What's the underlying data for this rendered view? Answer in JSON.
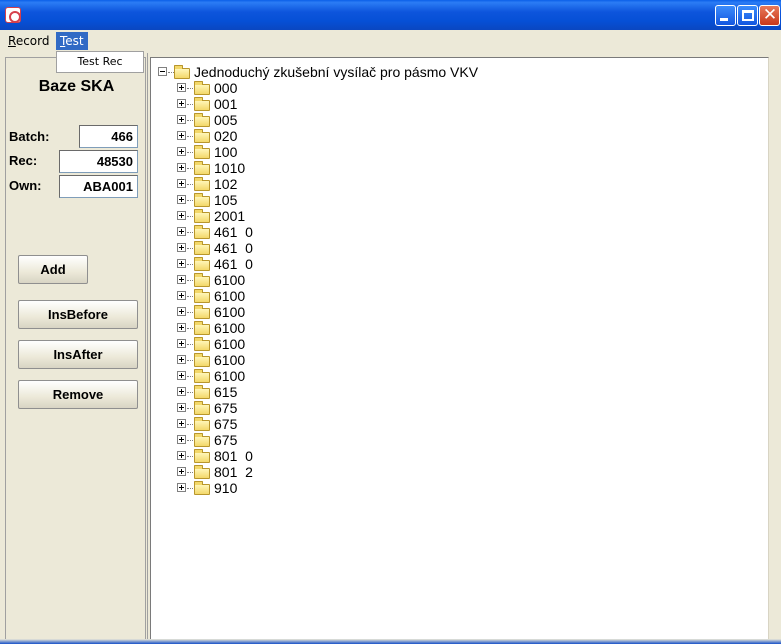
{
  "window": {
    "title": ""
  },
  "menu": {
    "items": [
      {
        "label": "Record",
        "accel": "R",
        "rest": "ecord"
      },
      {
        "label": "Test",
        "accel": "T",
        "rest": "est"
      }
    ],
    "open_dropdown": {
      "items": [
        "Test Rec"
      ]
    }
  },
  "left_panel": {
    "title": "Baze SKA",
    "fields": [
      {
        "label": "Batch:",
        "value": "466"
      },
      {
        "label": "Rec:",
        "value": "48530"
      },
      {
        "label": "Own:",
        "value": "ABA001"
      }
    ],
    "buttons": [
      "Add",
      "InsBefore",
      "InsAfter",
      "Remove"
    ]
  },
  "tree": {
    "root": {
      "label": "Jednoduchý zkušební vysílač pro pásmo VKV",
      "expanded": true
    },
    "children": [
      "000",
      "001",
      "005",
      "020",
      "100",
      "1010",
      "102",
      "105",
      "2001",
      "461  0",
      "461  0",
      "461  0",
      "6100",
      "6100",
      "6100",
      "6100",
      "6100",
      "6100",
      "6100",
      "615",
      "675",
      "675",
      "675",
      "801  0",
      "801  2",
      "910"
    ]
  },
  "colors": {
    "titlebar": "#0a55dc",
    "menu_highlight": "#316ac5",
    "face": "#ece9d8",
    "folder": "#f3d86a"
  }
}
